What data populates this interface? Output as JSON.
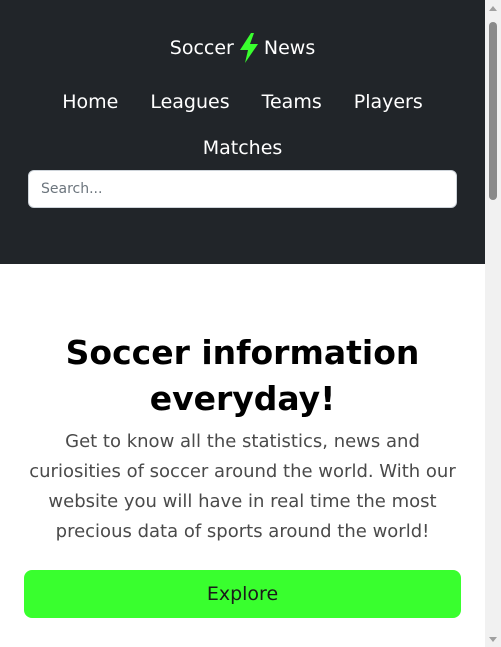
{
  "header": {
    "brand_left": "Soccer",
    "brand_right": "News",
    "bolt_icon": "lightning-bolt-icon",
    "bolt_color": "#39ff2e",
    "nav": [
      {
        "label": "Home"
      },
      {
        "label": "Leagues"
      },
      {
        "label": "Teams"
      },
      {
        "label": "Players"
      },
      {
        "label": "Matches"
      }
    ],
    "search": {
      "placeholder": "Search...",
      "value": ""
    },
    "background": "#212529"
  },
  "hero": {
    "title": "Soccer information everyday!",
    "text": "Get to know all the statistics, news and curiosities of soccer around the world. With our website you will have in real time the most precious data of sports around the world!",
    "button_label": "Explore",
    "button_color": "#39ff2e"
  }
}
